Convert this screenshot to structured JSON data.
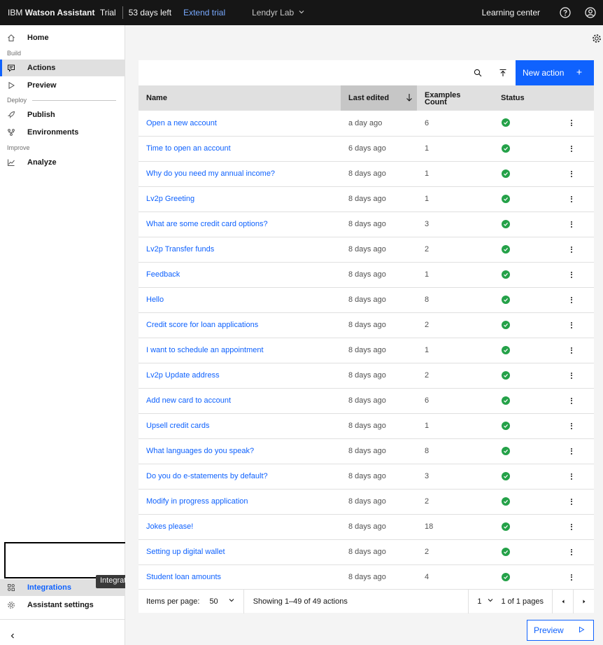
{
  "topbar": {
    "brand_ibm": "IBM",
    "brand_product": "Watson Assistant",
    "brand_plan": "Trial",
    "days_left": "53 days left",
    "extend_trial": "Extend trial",
    "workspace": "Lendyr Lab",
    "learning_center": "Learning center"
  },
  "sidebar": {
    "home": "Home",
    "section_build": "Build",
    "actions": "Actions",
    "preview": "Preview",
    "section_deploy": "Deploy",
    "publish": "Publish",
    "environments": "Environments",
    "section_improve": "Improve",
    "analyze": "Analyze",
    "integrations": "Integrations",
    "assistant_settings": "Assistant settings",
    "tooltip": "Integrations"
  },
  "toolbar": {
    "new_action": "New action"
  },
  "table": {
    "headers": {
      "name": "Name",
      "last_edited": "Last edited",
      "examples_line1": "Examples",
      "examples_line2": "Count",
      "status": "Status"
    },
    "rows": [
      {
        "name": "Open a new account",
        "edited": "a day ago",
        "count": "6"
      },
      {
        "name": "Time to open an account",
        "edited": "6 days ago",
        "count": "1"
      },
      {
        "name": "Why do you need my annual income?",
        "edited": "8 days ago",
        "count": "1"
      },
      {
        "name": "Lv2p Greeting",
        "edited": "8 days ago",
        "count": "1"
      },
      {
        "name": "What are some credit card options?",
        "edited": "8 days ago",
        "count": "3"
      },
      {
        "name": "Lv2p Transfer funds",
        "edited": "8 days ago",
        "count": "2"
      },
      {
        "name": "Feedback",
        "edited": "8 days ago",
        "count": "1"
      },
      {
        "name": "Hello",
        "edited": "8 days ago",
        "count": "8"
      },
      {
        "name": "Credit score for loan applications",
        "edited": "8 days ago",
        "count": "2"
      },
      {
        "name": "I want to schedule an appointment",
        "edited": "8 days ago",
        "count": "1"
      },
      {
        "name": "Lv2p Update address",
        "edited": "8 days ago",
        "count": "2"
      },
      {
        "name": "Add new card to account",
        "edited": "8 days ago",
        "count": "6"
      },
      {
        "name": "Upsell credit cards",
        "edited": "8 days ago",
        "count": "1"
      },
      {
        "name": "What languages do you speak?",
        "edited": "8 days ago",
        "count": "8"
      },
      {
        "name": "Do you do e-statements by default?",
        "edited": "8 days ago",
        "count": "3"
      },
      {
        "name": "Modify in progress application",
        "edited": "8 days ago",
        "count": "2"
      },
      {
        "name": "Jokes please!",
        "edited": "8 days ago",
        "count": "18"
      },
      {
        "name": "Setting up digital wallet",
        "edited": "8 days ago",
        "count": "2"
      },
      {
        "name": "Student loan amounts",
        "edited": "8 days ago",
        "count": "4"
      }
    ]
  },
  "pagination": {
    "items_per_page_label": "Items per page:",
    "items_per_page": "50",
    "showing": "Showing 1–49 of 49 actions",
    "page": "1",
    "of_pages": "1 of 1 pages"
  },
  "preview_button": "Preview",
  "colors": {
    "accent": "#0f62fe",
    "status_ok": "#24a148",
    "topbar_bg": "#161616"
  }
}
